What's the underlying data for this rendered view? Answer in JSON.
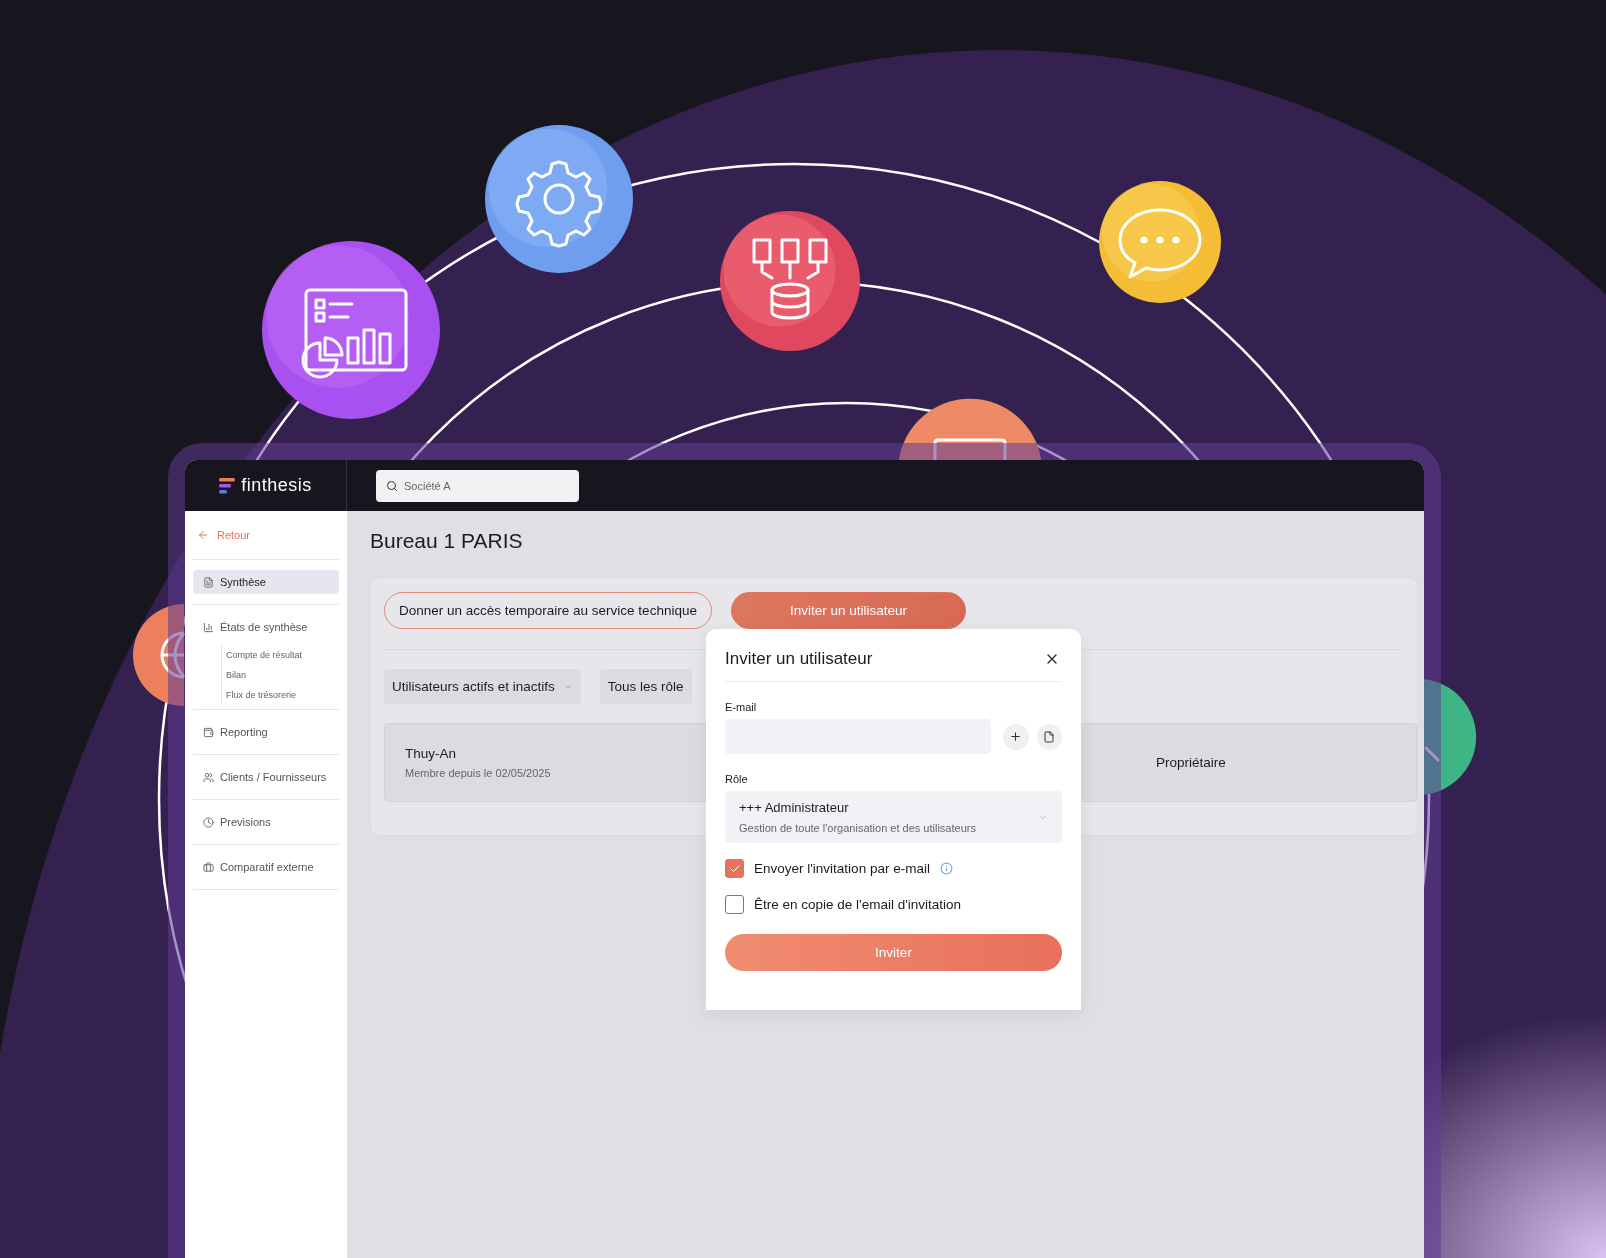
{
  "brand": {
    "name": "finthesis"
  },
  "search": {
    "value": "Société A"
  },
  "sidebar": {
    "back": "Retour",
    "items": [
      {
        "label": "Synthèse",
        "selected": true
      },
      {
        "label": "États de synthèse",
        "selected": false,
        "children": [
          {
            "label": "Compte de résultat"
          },
          {
            "label": "Bilan"
          },
          {
            "label": "Flux de trésorerie"
          }
        ]
      },
      {
        "label": "Reporting",
        "selected": false
      },
      {
        "label": "Clients / Fournisseurs",
        "selected": false
      },
      {
        "label": "Previsions",
        "selected": false
      },
      {
        "label": "Comparatif externe",
        "selected": false
      }
    ]
  },
  "page": {
    "title": "Bureau 1 PARIS",
    "actions": [
      {
        "kind": "outline",
        "label": "Donner un accès temporaire au service technique"
      },
      {
        "kind": "primary",
        "label": "Inviter un utilisateur"
      }
    ],
    "filters": [
      {
        "label": "Utilisateurs actifs et inactifs"
      },
      {
        "label": "Tous les rôle"
      }
    ],
    "users": [
      {
        "name": "Thuy-An",
        "since": "Membre depuis le 02/05/2025",
        "role": "Propriétaire"
      }
    ]
  },
  "modal": {
    "title": "Inviter un utilisateur",
    "email": {
      "label": "E-mail"
    },
    "role": {
      "label": "Rôle",
      "value": "+++ Administrateur",
      "description": "Gestion de toute l'organisation et des utilisateurs"
    },
    "options": [
      {
        "label": "Envoyer l'invitation par e-mail",
        "checked": true,
        "info": true
      },
      {
        "label": "Être en copie de l'email d'invitation",
        "checked": false,
        "info": false
      }
    ],
    "submit": "Inviter"
  }
}
